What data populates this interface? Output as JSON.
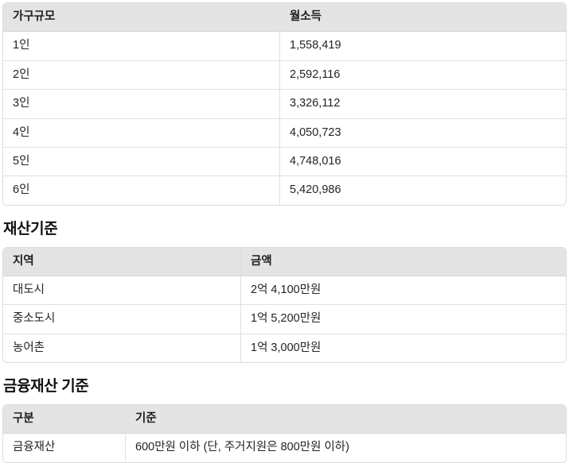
{
  "theme": {
    "page_background": "#ffffff",
    "header_background": "#e4e4e4",
    "border_color": "#dcdcdc",
    "row_divider_color": "#e0e0e0",
    "text_color": "#232323",
    "heading_color": "#111111"
  },
  "sections": [
    {
      "id": "income-standard",
      "heading": null,
      "table": {
        "name": "income-table",
        "columns": [
          "가구규모",
          "월소득"
        ],
        "rows": [
          [
            "1인",
            "1,558,419"
          ],
          [
            "2인",
            "2,592,116"
          ],
          [
            "3인",
            "3,326,112"
          ],
          [
            "4인",
            "4,050,723"
          ],
          [
            "5인",
            "4,748,016"
          ],
          [
            "6인",
            "5,420,986"
          ]
        ]
      }
    },
    {
      "id": "asset-standard",
      "heading": "재산기준",
      "table": {
        "name": "asset-table",
        "columns": [
          "지역",
          "금액"
        ],
        "rows": [
          [
            "대도시",
            "2억 4,100만원"
          ],
          [
            "중소도시",
            "1억 5,200만원"
          ],
          [
            "농어촌",
            "1억 3,000만원"
          ]
        ]
      }
    },
    {
      "id": "financial-asset-standard",
      "heading": "금융재산 기준",
      "table": {
        "name": "financial-asset-table",
        "columns": [
          "구분",
          "기준"
        ],
        "rows": [
          [
            "금융재산",
            "600만원 이하 (단, 주거지원은 800만원 이하)"
          ]
        ]
      }
    }
  ]
}
